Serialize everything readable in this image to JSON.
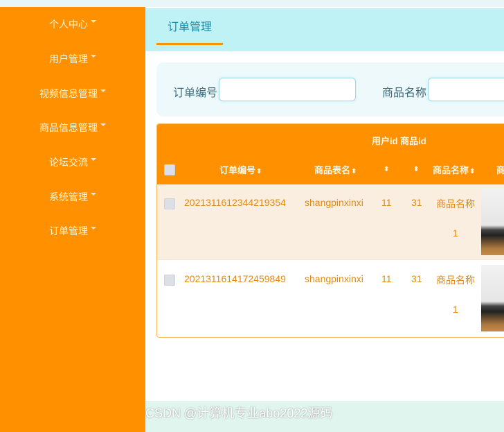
{
  "sidebar": {
    "items": [
      {
        "label": "个人中心"
      },
      {
        "label": "用户管理"
      },
      {
        "label": "视频信息管理"
      },
      {
        "label": "商品信息管理"
      },
      {
        "label": "论坛交流"
      },
      {
        "label": "系统管理"
      },
      {
        "label": "订单管理"
      }
    ]
  },
  "tabs": [
    {
      "label": "订单管理"
    }
  ],
  "search": {
    "order_no_label": "订单编号",
    "order_no_value": "",
    "product_name_label": "商品名称",
    "product_name_value": ""
  },
  "table": {
    "group_header": "用户id 商品id",
    "columns": [
      "订单编号",
      "商品表名",
      "",
      "",
      "商品名称",
      "商"
    ],
    "rows": [
      {
        "order_no": "2021311612344219354",
        "table_name": "shangpinxinxi",
        "user_id": "11",
        "product_id": "31",
        "product_name_1": "商品名称",
        "product_name_2": "1"
      },
      {
        "order_no": "2021311614172459849",
        "table_name": "shangpinxinxi",
        "user_id": "11",
        "product_id": "31",
        "product_name_1": "商品名称",
        "product_name_2": "1"
      }
    ]
  },
  "watermark": "CSDN @计算机专业abo2022源码",
  "colors": {
    "sidebar_bg": "#ff9000",
    "table_header_bg": "#ff9000",
    "tab_bar_bg": "#bff2f4",
    "accent_text": "#e08a12"
  }
}
